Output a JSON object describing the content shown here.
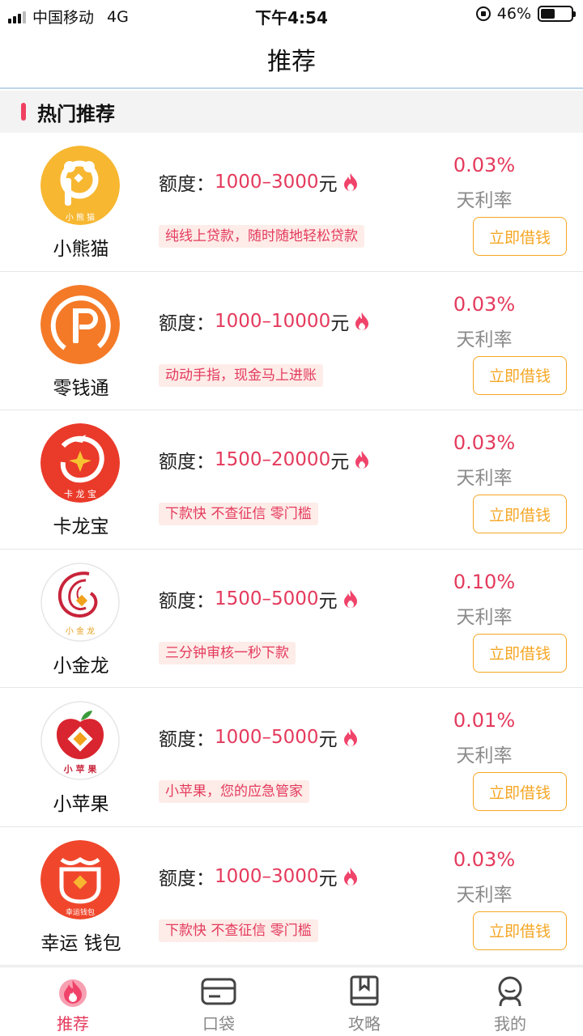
{
  "status_bar": {
    "carrier": "中国移动",
    "network": "4G",
    "time": "下午4:54",
    "battery": "46%"
  },
  "nav": {
    "title": "推荐"
  },
  "section": {
    "title": "热门推荐"
  },
  "products": [
    {
      "logo_text": "小 熊 猫",
      "name": "小熊猫",
      "limit_label": "额度：",
      "limit_range": "1000–3000",
      "limit_unit": "元",
      "tag": "纯线上贷款，随时随地轻松贷款",
      "rate": "0.03%",
      "rate_label": "天利率",
      "button": "立即借钱"
    },
    {
      "logo_text": "",
      "name": "零钱通",
      "limit_label": "额度：",
      "limit_range": "1000–10000",
      "limit_unit": "元",
      "tag": "动动手指，现金马上进账",
      "rate": "0.03%",
      "rate_label": "天利率",
      "button": "立即借钱"
    },
    {
      "logo_text": "卡 龙 宝",
      "name": "卡龙宝",
      "limit_label": "额度：",
      "limit_range": "1500–20000",
      "limit_unit": "元",
      "tag": "下款快 不查征信 零门槛",
      "rate": "0.03%",
      "rate_label": "天利率",
      "button": "立即借钱"
    },
    {
      "logo_text": "小 金 龙",
      "name": "小金龙",
      "limit_label": "额度：",
      "limit_range": "1500–5000",
      "limit_unit": "元",
      "tag": "三分钟审核一秒下款",
      "rate": "0.10%",
      "rate_label": "天利率",
      "button": "立即借钱"
    },
    {
      "logo_text": "小 苹 果",
      "name": "小苹果",
      "limit_label": "额度：",
      "limit_range": "1000–5000",
      "limit_unit": "元",
      "tag": "小苹果，您的应急管家",
      "rate": "0.01%",
      "rate_label": "天利率",
      "button": "立即借钱"
    },
    {
      "logo_text": "幸运钱包",
      "name": "幸运 钱包",
      "limit_label": "额度：",
      "limit_range": "1000–3000",
      "limit_unit": "元",
      "tag": "下款快 不查征信 零门槛",
      "rate": "0.03%",
      "rate_label": "天利率",
      "button": "立即借钱"
    }
  ],
  "tabs": [
    {
      "label": "推荐",
      "icon": "flame-icon",
      "active": true
    },
    {
      "label": "口袋",
      "icon": "card-icon",
      "active": false
    },
    {
      "label": "攻略",
      "icon": "book-icon",
      "active": false
    },
    {
      "label": "我的",
      "icon": "user-icon",
      "active": false
    }
  ],
  "colors": {
    "accent": "#e43a5c",
    "button": "#f5a623",
    "tag_bg": "#fdece8",
    "muted": "#8a8a8a"
  }
}
